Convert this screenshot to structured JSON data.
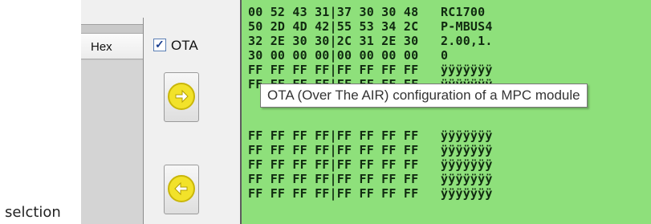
{
  "caption": "selction",
  "header": {
    "hex_column": "Hex"
  },
  "ota": {
    "label": "OTA",
    "checked": true
  },
  "tooltip": "OTA (Over The AIR) configuration of a MPC module",
  "buttons": [
    {
      "icon": "forward-arrow-icon"
    },
    {
      "icon": "back-arrow-icon"
    }
  ],
  "hex_dump": [
    "00 52 43 31|37 30 30 48   RC1700",
    "50 2D 4D 42|55 53 34 2C   P-MBUS4",
    "32 2E 30 30|2C 31 2E 30   2.00,1.",
    "30 00 00 00|00 00 00 00   0",
    "FF FF FF FF|FF FF FF FF   ÿÿÿÿÿÿÿ",
    "FF FF FF FF|FF FF FF FF   ÿÿÿÿÿÿÿ",
    "FF FF FF FF|FF FF FF FF   ÿÿÿÿÿÿÿ",
    "FF FF FF FF|FF FF FF FF   ÿÿÿÿÿÿÿ",
    "FF FF FF FF|FF FF FF FF   ÿÿÿÿÿÿÿ",
    "FF FF FF FF|FF FF FF FF   ÿÿÿÿÿÿÿ",
    "FF FF FF FF|FF FF FF FF   ÿÿÿÿÿÿÿ"
  ],
  "colors": {
    "hex_background": "#8ee07b",
    "icon_yellow": "#f2e22a"
  }
}
